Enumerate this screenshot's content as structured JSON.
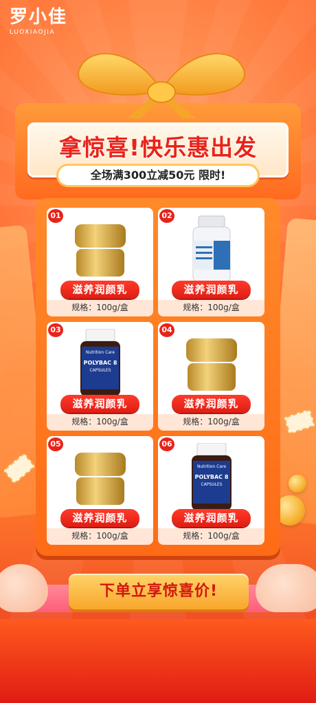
{
  "logo": {
    "cn": "罗小佳",
    "en": "LUOXIAOJIA"
  },
  "header": {
    "title": "拿惊喜!快乐惠出发",
    "subtitle": "全场满300立减50元 限时!"
  },
  "products": [
    {
      "num": "01",
      "name": "滋养润颜乳",
      "spec": "规格：100g/盒",
      "image": "gold-jar"
    },
    {
      "num": "02",
      "name": "滋养润颜乳",
      "spec": "规格：100g/盒",
      "image": "white-bottle"
    },
    {
      "num": "03",
      "name": "滋养润颜乳",
      "spec": "规格：100g/盒",
      "image": "dark-bottle"
    },
    {
      "num": "04",
      "name": "滋养润颜乳",
      "spec": "规格：100g/盒",
      "image": "gold-jar"
    },
    {
      "num": "05",
      "name": "滋养润颜乳",
      "spec": "规格：100g/盒",
      "image": "gold-jar"
    },
    {
      "num": "06",
      "name": "滋养润颜乳",
      "spec": "规格：100g/盒",
      "image": "dark-bottle"
    }
  ],
  "bottle_labels": {
    "brand": "Nutrition Care",
    "product": "POLYBAC 8",
    "form": "CAPSULES"
  },
  "cta": {
    "label": "下单立享惊喜价!"
  },
  "colors": {
    "accent": "#e8231a",
    "orange": "#ff6a1f",
    "gold": "#f9a62c"
  }
}
